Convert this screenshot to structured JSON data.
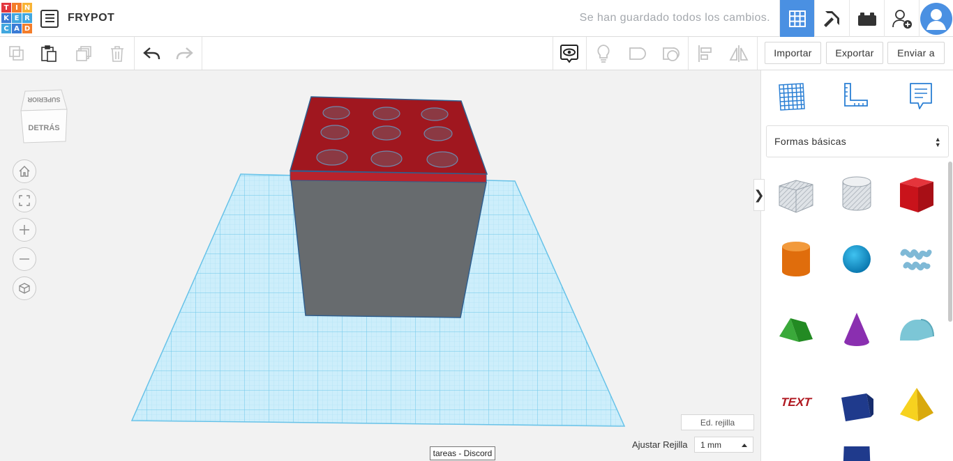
{
  "header": {
    "logo_letters": [
      "T",
      "I",
      "N",
      "K",
      "E",
      "R",
      "C",
      "A",
      "D"
    ],
    "logo_colors": [
      "#e2373f",
      "#f47d2a",
      "#f8b335",
      "#3a7bd5",
      "#41a7df",
      "#41a7df",
      "#41a7df",
      "#3a7bd5",
      "#f47d2a"
    ],
    "project_title": "FRYPOT",
    "save_status": "Se han guardado todos los cambios.",
    "buttons": [
      "grid-view-icon",
      "pickaxe-icon",
      "bricks-icon",
      "add-user-icon",
      "avatar"
    ]
  },
  "toolbar": {
    "import_label": "Importar",
    "export_label": "Exportar",
    "send_label": "Enviar a"
  },
  "viewcube": {
    "top_face": "SUPERIOR",
    "front_face": "DETRÁS"
  },
  "workspace": {
    "edit_grid_label": "Ed. rejilla",
    "snap_label": "Ajustar Rejilla",
    "snap_value": "1 mm",
    "tooltip": "tareas - Discord",
    "collapse_glyph": "❯"
  },
  "panel": {
    "category": "Formas básicas",
    "tabs": [
      "workplane-icon",
      "ruler-icon",
      "notes-icon"
    ],
    "shapes": [
      "Caja agujero",
      "Cilindro agujero",
      "Caja",
      "Cilindro",
      "Esfera",
      "Garabato",
      "Techo",
      "Cono",
      "Techo redondo",
      "Texto",
      "Prisma",
      "Pirámide"
    ]
  },
  "colors": {
    "accent": "#4a90e2",
    "box_top": "#a0171f",
    "box_body": "#676b6e",
    "grid": "#7fd1ee"
  }
}
